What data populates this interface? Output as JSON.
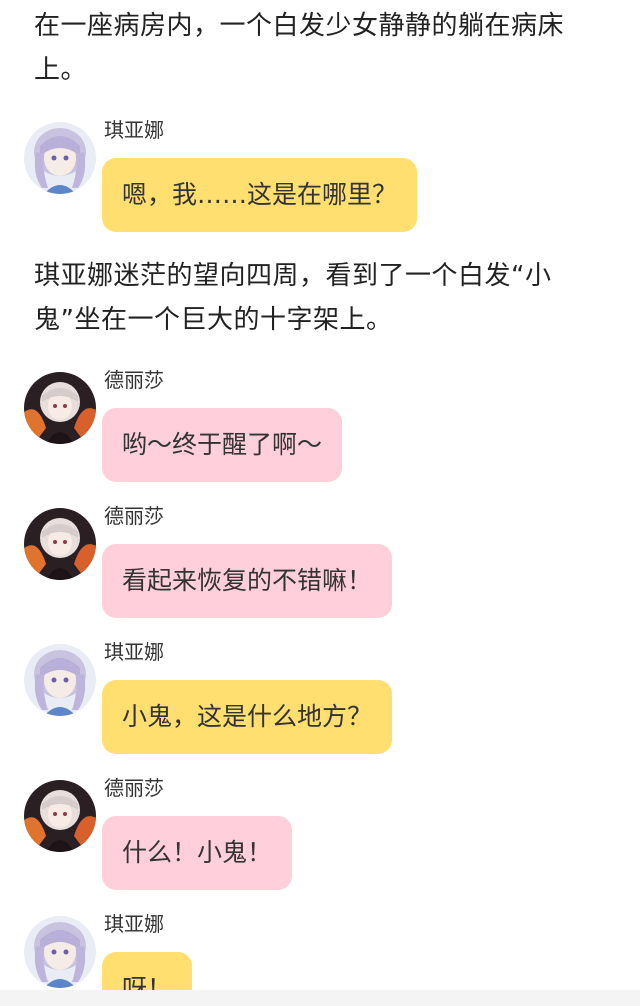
{
  "narration": [
    "在一座病房内，一个白发少女静静的躺在病床上。",
    "琪亚娜迷茫的望向四周，看到了一个白发“小鬼”坐在一个巨大的十字架上。"
  ],
  "messages": [
    {
      "speaker": "琪亚娜",
      "text": "嗯，我……这是在哪里？",
      "bubble_color": "#ffdf6f",
      "avatar": "kiana-avatar"
    },
    {
      "speaker": "德丽莎",
      "text": "哟～终于醒了啊～",
      "bubble_color": "#ffd0dc",
      "avatar": "theresa-avatar"
    },
    {
      "speaker": "德丽莎",
      "text": "看起来恢复的不错嘛！",
      "bubble_color": "#ffd0dc",
      "avatar": "theresa-avatar"
    },
    {
      "speaker": "琪亚娜",
      "text": "小鬼，这是什么地方？",
      "bubble_color": "#ffdf6f",
      "avatar": "kiana-avatar"
    },
    {
      "speaker": "德丽莎",
      "text": "什么！小鬼！",
      "bubble_color": "#ffd0dc",
      "avatar": "theresa-avatar"
    },
    {
      "speaker": "琪亚娜",
      "text": "呀！",
      "bubble_color": "#ffdf6f",
      "avatar": "kiana-avatar"
    }
  ]
}
